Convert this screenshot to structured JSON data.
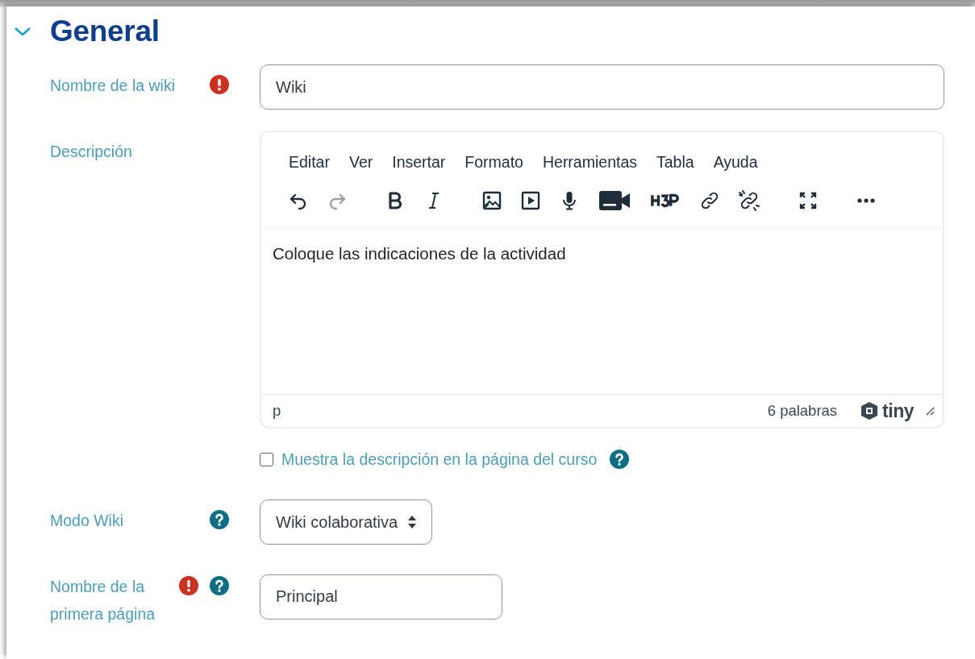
{
  "section": {
    "title": "General",
    "expanded": true
  },
  "fields": [
    {
      "kind": "text",
      "label": "Nombre de la wiki",
      "required": true,
      "help": false,
      "value": "Wiki",
      "wide": true
    },
    {
      "kind": "editor",
      "label": "Descripción",
      "required": false,
      "help": false,
      "menu": [
        "Editar",
        "Ver",
        "Insertar",
        "Formato",
        "Herramientas",
        "Tabla",
        "Ayuda"
      ],
      "toolbar": [
        {
          "kind": "undo",
          "disabled": false
        },
        {
          "kind": "redo",
          "disabled": true
        },
        {
          "kind": "bold",
          "disabled": false
        },
        {
          "kind": "italic",
          "disabled": false
        },
        {
          "kind": "image",
          "disabled": false
        },
        {
          "kind": "media",
          "disabled": false
        },
        {
          "kind": "audio",
          "disabled": false
        },
        {
          "kind": "video",
          "disabled": false
        },
        {
          "kind": "h5p",
          "disabled": false
        },
        {
          "kind": "link",
          "disabled": false
        },
        {
          "kind": "unlink",
          "disabled": false
        },
        {
          "kind": "fullscreen",
          "disabled": false
        },
        {
          "kind": "more",
          "disabled": false
        }
      ],
      "content": "Coloque las indicaciones de la actividad",
      "path": "p",
      "word_count": "6 palabras",
      "logo": "tiny"
    },
    {
      "kind": "checkbox",
      "label": "Muestra la descripción en la página del curso",
      "checked": false,
      "help": true
    },
    {
      "kind": "select",
      "label": "Modo Wiki",
      "required": false,
      "help": true,
      "value": "Wiki colaborativa"
    },
    {
      "kind": "text",
      "label": "Nombre de la primera página",
      "required": true,
      "help": true,
      "value": "Principal",
      "wide": false
    }
  ]
}
